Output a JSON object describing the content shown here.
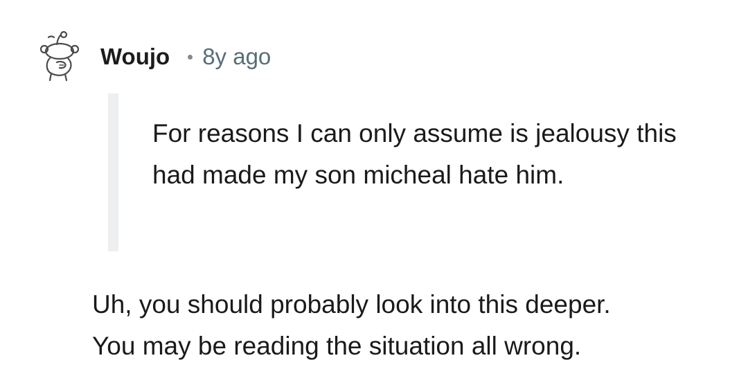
{
  "comment": {
    "author": "Woujo",
    "age": "8y ago",
    "quote": "For reasons I can only assume is jealousy this had made my son micheal hate him.",
    "body_lines": [
      "Uh, you should probably look into this deeper.",
      "You may be reading the situation all wrong."
    ]
  },
  "icons": {
    "avatar": "snoo-avatar-icon",
    "separator": "dot-separator"
  },
  "colors": {
    "text": "#1a1a1b",
    "muted": "#576f76",
    "quote_bar": "#edeff1",
    "background": "#ffffff"
  }
}
